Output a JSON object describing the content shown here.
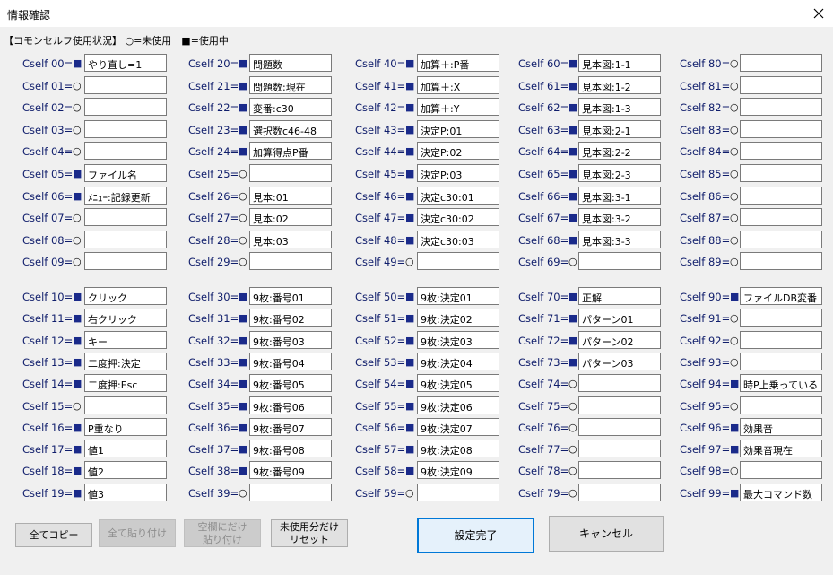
{
  "window": {
    "title": "情報確認"
  },
  "legend": "【コモンセルフ使用状況】 ○=未使用　■=使用中",
  "marks": {
    "unused": "○",
    "used": "■"
  },
  "columns": [
    {
      "cells": [
        {
          "label": "Cself 00=",
          "used": true,
          "value": "やり直し=1"
        },
        {
          "label": "Cself 01=",
          "used": false,
          "value": ""
        },
        {
          "label": "Cself 02=",
          "used": false,
          "value": ""
        },
        {
          "label": "Cself 03=",
          "used": false,
          "value": ""
        },
        {
          "label": "Cself 04=",
          "used": false,
          "value": ""
        },
        {
          "label": "Cself 05=",
          "used": true,
          "value": "ファイル名"
        },
        {
          "label": "Cself 06=",
          "used": true,
          "value": "ﾒﾆｭｰ:記録更新"
        },
        {
          "label": "Cself 07=",
          "used": false,
          "value": ""
        },
        {
          "label": "Cself 08=",
          "used": false,
          "value": ""
        },
        {
          "label": "Cself 09=",
          "used": false,
          "value": ""
        },
        {
          "label": "Cself 10=",
          "used": true,
          "value": "クリック"
        },
        {
          "label": "Cself 11=",
          "used": true,
          "value": "右クリック"
        },
        {
          "label": "Cself 12=",
          "used": true,
          "value": "キー"
        },
        {
          "label": "Cself 13=",
          "used": true,
          "value": "二度押:決定"
        },
        {
          "label": "Cself 14=",
          "used": true,
          "value": "二度押:Esc"
        },
        {
          "label": "Cself 15=",
          "used": false,
          "value": ""
        },
        {
          "label": "Cself 16=",
          "used": true,
          "value": "P重なり"
        },
        {
          "label": "Cself 17=",
          "used": true,
          "value": "値1"
        },
        {
          "label": "Cself 18=",
          "used": true,
          "value": "値2"
        },
        {
          "label": "Cself 19=",
          "used": true,
          "value": "値3"
        }
      ]
    },
    {
      "cells": [
        {
          "label": "Cself 20=",
          "used": true,
          "value": "問題数"
        },
        {
          "label": "Cself 21=",
          "used": true,
          "value": "問題数:現在"
        },
        {
          "label": "Cself 22=",
          "used": true,
          "value": "変番:c30"
        },
        {
          "label": "Cself 23=",
          "used": true,
          "value": "選択数c46-48"
        },
        {
          "label": "Cself 24=",
          "used": true,
          "value": "加算得点P番"
        },
        {
          "label": "Cself 25=",
          "used": false,
          "value": ""
        },
        {
          "label": "Cself 26=",
          "used": false,
          "value": "見本:01"
        },
        {
          "label": "Cself 27=",
          "used": false,
          "value": "見本:02"
        },
        {
          "label": "Cself 28=",
          "used": false,
          "value": "見本:03"
        },
        {
          "label": "Cself 29=",
          "used": false,
          "value": ""
        },
        {
          "label": "Cself 30=",
          "used": true,
          "value": "9枚:番号01"
        },
        {
          "label": "Cself 31=",
          "used": true,
          "value": "9枚:番号02"
        },
        {
          "label": "Cself 32=",
          "used": true,
          "value": "9枚:番号03"
        },
        {
          "label": "Cself 33=",
          "used": true,
          "value": "9枚:番号04"
        },
        {
          "label": "Cself 34=",
          "used": true,
          "value": "9枚:番号05"
        },
        {
          "label": "Cself 35=",
          "used": true,
          "value": "9枚:番号06"
        },
        {
          "label": "Cself 36=",
          "used": true,
          "value": "9枚:番号07"
        },
        {
          "label": "Cself 37=",
          "used": true,
          "value": "9枚:番号08"
        },
        {
          "label": "Cself 38=",
          "used": true,
          "value": "9枚:番号09"
        },
        {
          "label": "Cself 39=",
          "used": false,
          "value": ""
        }
      ]
    },
    {
      "cells": [
        {
          "label": "Cself 40=",
          "used": true,
          "value": "加算＋:P番"
        },
        {
          "label": "Cself 41=",
          "used": true,
          "value": "加算＋:X"
        },
        {
          "label": "Cself 42=",
          "used": true,
          "value": "加算＋:Y"
        },
        {
          "label": "Cself 43=",
          "used": true,
          "value": "決定P:01"
        },
        {
          "label": "Cself 44=",
          "used": true,
          "value": "決定P:02"
        },
        {
          "label": "Cself 45=",
          "used": true,
          "value": "決定P:03"
        },
        {
          "label": "Cself 46=",
          "used": true,
          "value": "決定c30:01"
        },
        {
          "label": "Cself 47=",
          "used": true,
          "value": "決定c30:02"
        },
        {
          "label": "Cself 48=",
          "used": true,
          "value": "決定c30:03"
        },
        {
          "label": "Cself 49=",
          "used": false,
          "value": ""
        },
        {
          "label": "Cself 50=",
          "used": true,
          "value": "9枚:決定01"
        },
        {
          "label": "Cself 51=",
          "used": true,
          "value": "9枚:決定02"
        },
        {
          "label": "Cself 52=",
          "used": true,
          "value": "9枚:決定03"
        },
        {
          "label": "Cself 53=",
          "used": true,
          "value": "9枚:決定04"
        },
        {
          "label": "Cself 54=",
          "used": true,
          "value": "9枚:決定05"
        },
        {
          "label": "Cself 55=",
          "used": true,
          "value": "9枚:決定06"
        },
        {
          "label": "Cself 56=",
          "used": true,
          "value": "9枚:決定07"
        },
        {
          "label": "Cself 57=",
          "used": true,
          "value": "9枚:決定08"
        },
        {
          "label": "Cself 58=",
          "used": true,
          "value": "9枚:決定09"
        },
        {
          "label": "Cself 59=",
          "used": false,
          "value": ""
        }
      ]
    },
    {
      "cells": [
        {
          "label": "Cself 60=",
          "used": true,
          "value": "見本図:1-1"
        },
        {
          "label": "Cself 61=",
          "used": true,
          "value": "見本図:1-2"
        },
        {
          "label": "Cself 62=",
          "used": true,
          "value": "見本図:1-3"
        },
        {
          "label": "Cself 63=",
          "used": true,
          "value": "見本図:2-1"
        },
        {
          "label": "Cself 64=",
          "used": true,
          "value": "見本図:2-2"
        },
        {
          "label": "Cself 65=",
          "used": true,
          "value": "見本図:2-3"
        },
        {
          "label": "Cself 66=",
          "used": true,
          "value": "見本図:3-1"
        },
        {
          "label": "Cself 67=",
          "used": true,
          "value": "見本図:3-2"
        },
        {
          "label": "Cself 68=",
          "used": true,
          "value": "見本図:3-3"
        },
        {
          "label": "Cself 69=",
          "used": false,
          "value": ""
        },
        {
          "label": "Cself 70=",
          "used": true,
          "value": "正解"
        },
        {
          "label": "Cself 71=",
          "used": true,
          "value": "パターン01"
        },
        {
          "label": "Cself 72=",
          "used": true,
          "value": "パターン02"
        },
        {
          "label": "Cself 73=",
          "used": true,
          "value": "パターン03"
        },
        {
          "label": "Cself 74=",
          "used": false,
          "value": ""
        },
        {
          "label": "Cself 75=",
          "used": false,
          "value": ""
        },
        {
          "label": "Cself 76=",
          "used": false,
          "value": ""
        },
        {
          "label": "Cself 77=",
          "used": false,
          "value": ""
        },
        {
          "label": "Cself 78=",
          "used": false,
          "value": ""
        },
        {
          "label": "Cself 79=",
          "used": false,
          "value": ""
        }
      ]
    },
    {
      "cells": [
        {
          "label": "Cself 80=",
          "used": false,
          "value": ""
        },
        {
          "label": "Cself 81=",
          "used": false,
          "value": ""
        },
        {
          "label": "Cself 82=",
          "used": false,
          "value": ""
        },
        {
          "label": "Cself 83=",
          "used": false,
          "value": ""
        },
        {
          "label": "Cself 84=",
          "used": false,
          "value": ""
        },
        {
          "label": "Cself 85=",
          "used": false,
          "value": ""
        },
        {
          "label": "Cself 86=",
          "used": false,
          "value": ""
        },
        {
          "label": "Cself 87=",
          "used": false,
          "value": ""
        },
        {
          "label": "Cself 88=",
          "used": false,
          "value": ""
        },
        {
          "label": "Cself 89=",
          "used": false,
          "value": ""
        },
        {
          "label": "Cself 90=",
          "used": true,
          "value": "ファイルDB変番"
        },
        {
          "label": "Cself 91=",
          "used": false,
          "value": ""
        },
        {
          "label": "Cself 92=",
          "used": false,
          "value": ""
        },
        {
          "label": "Cself 93=",
          "used": false,
          "value": ""
        },
        {
          "label": "Cself 94=",
          "used": true,
          "value": "時P上乗っている"
        },
        {
          "label": "Cself 95=",
          "used": false,
          "value": ""
        },
        {
          "label": "Cself 96=",
          "used": true,
          "value": "効果音"
        },
        {
          "label": "Cself 97=",
          "used": true,
          "value": "効果音現在"
        },
        {
          "label": "Cself 98=",
          "used": false,
          "value": ""
        },
        {
          "label": "Cself 99=",
          "used": true,
          "value": "最大コマンド数"
        }
      ]
    }
  ],
  "buttons": {
    "copy_all": "全てコピー",
    "paste_all": "全て貼り付け",
    "paste_empty_line1": "空欄にだけ",
    "paste_empty_line2": "貼り付け",
    "reset_unused_line1": "未使用分だけ",
    "reset_unused_line2": "リセット",
    "ok": "設定完了",
    "cancel": "キャンセル"
  }
}
